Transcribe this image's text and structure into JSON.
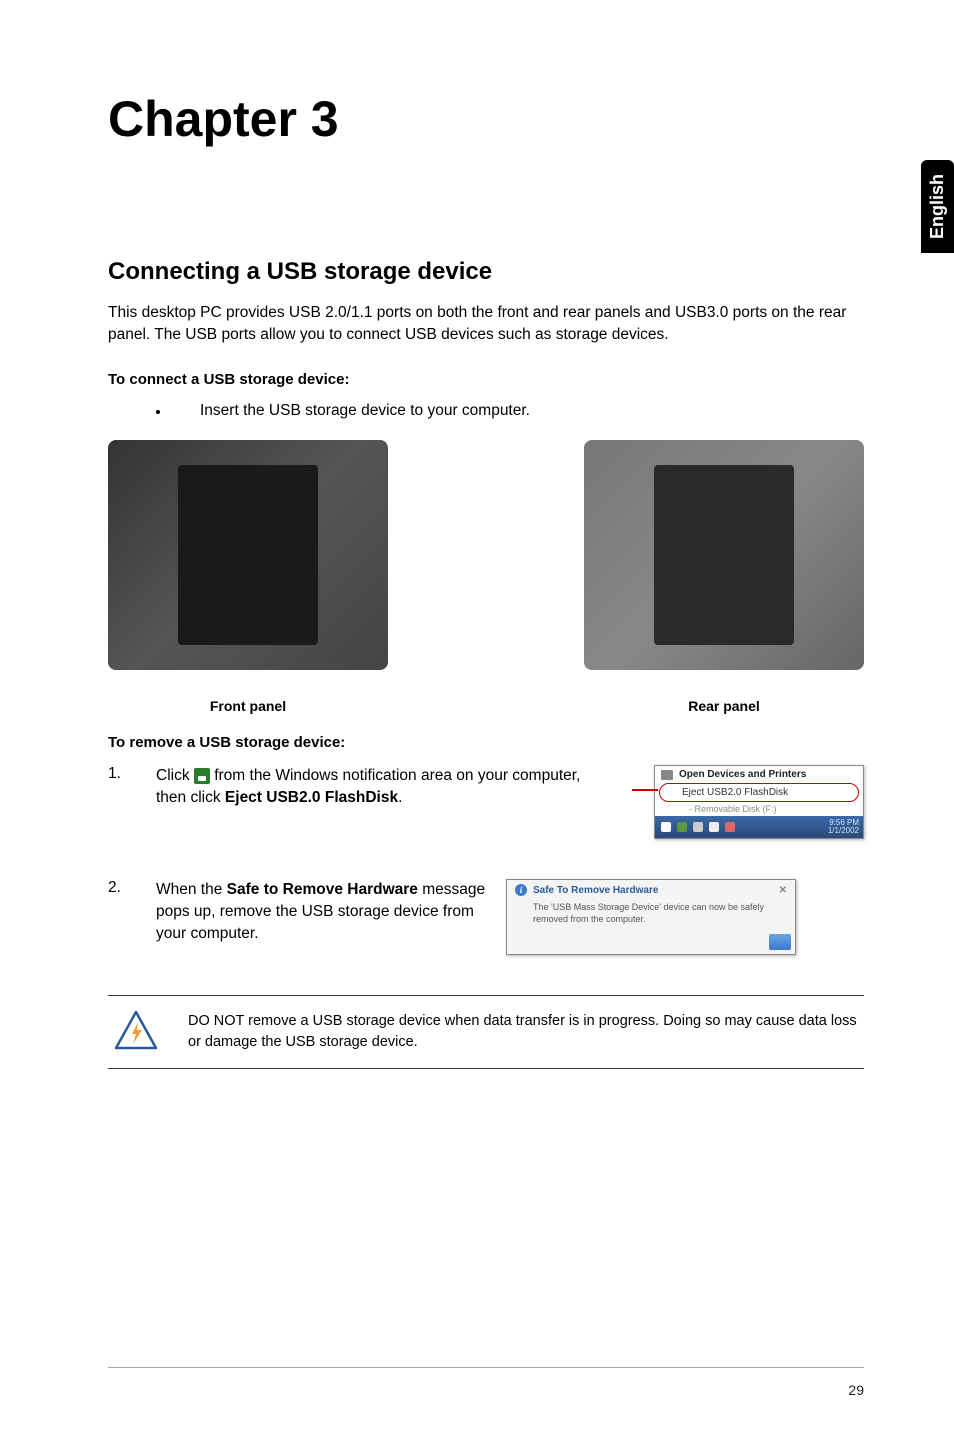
{
  "side_tab": "English",
  "chapter_title": "Chapter 3",
  "section_heading": "Connecting a USB storage device",
  "intro": "This desktop PC provides USB 2.0/1.1 ports on both the front and rear panels and USB3.0 ports on the rear panel. The USB ports allow you to connect USB devices such as storage devices.",
  "connect_heading": "To connect a USB storage device:",
  "connect_bullet": "Insert the USB storage device to your computer.",
  "panels": {
    "front_label": "Front panel",
    "rear_label": "Rear panel"
  },
  "remove_heading": "To remove a USB storage device:",
  "steps": [
    {
      "num": "1.",
      "prefix": "Click ",
      "mid": " from the Windows notification area on your computer, then click ",
      "bold": "Eject USB2.0 FlashDisk",
      "suffix": "."
    },
    {
      "num": "2.",
      "prefix": "When the ",
      "bold": "Safe to Remove Hardware",
      "suffix": " message pops up, remove the USB storage device from your computer."
    }
  ],
  "popup1": {
    "open_devices": "Open Devices and Printers",
    "eject": "Eject USB2.0 FlashDisk",
    "removable": "- Removable Disk (F:)",
    "time": "9:56 PM",
    "date": "1/1/2002"
  },
  "popup2": {
    "title": "Safe To Remove Hardware",
    "body": "The 'USB Mass Storage Device' device can now be safely removed from the computer."
  },
  "warning": "DO NOT remove a USB storage device when data transfer is in progress. Doing so may cause data loss or damage the USB storage device.",
  "page_number": "29"
}
